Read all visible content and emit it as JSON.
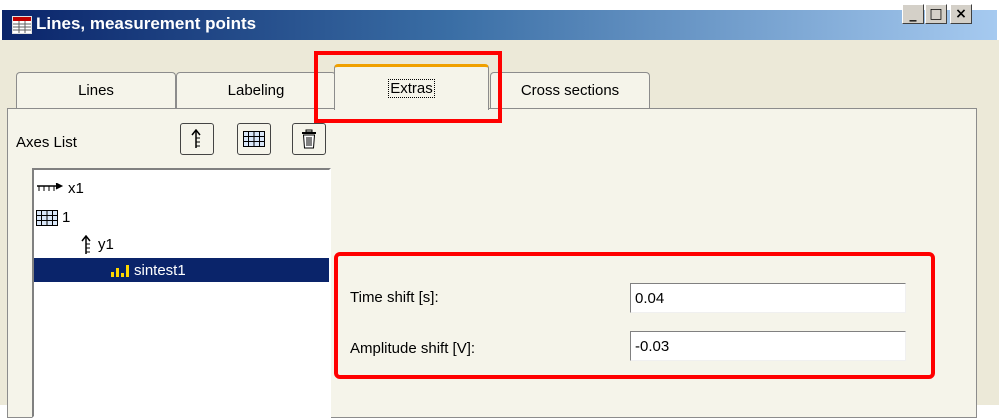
{
  "window": {
    "title": "Lines, measurement points",
    "controls": {
      "minimize": "_",
      "maximize": "□",
      "close": "×"
    }
  },
  "tabs": [
    {
      "label": "Lines",
      "selected": false
    },
    {
      "label": "Labeling",
      "selected": false
    },
    {
      "label": "Extras",
      "selected": true
    },
    {
      "label": "Cross sections",
      "selected": false
    }
  ],
  "axes_panel": {
    "label": "Axes List",
    "toolbar": [
      {
        "icon": "y-axis-icon"
      },
      {
        "icon": "grid-icon"
      },
      {
        "icon": "trash-icon"
      }
    ]
  },
  "tree": [
    {
      "label": "x1",
      "icon": "x-axis-icon",
      "level": 0,
      "selected": false
    },
    {
      "label": "1",
      "icon": "grid-icon",
      "level": 0,
      "selected": false
    },
    {
      "label": "y1",
      "icon": "y-axis-icon",
      "level": 1,
      "selected": false
    },
    {
      "label": "sintest1",
      "icon": "bar-signal-icon",
      "level": 2,
      "selected": true
    }
  ],
  "fields": {
    "time_shift": {
      "label": "Time shift [s]:",
      "value": "0.04"
    },
    "amplitude_shift": {
      "label": "Amplitude shift [V]:",
      "value": "-0.03"
    }
  },
  "colors": {
    "highlight": "#ff0000",
    "selection": "#0a246a",
    "active_tab_accent": "#f0a000"
  }
}
